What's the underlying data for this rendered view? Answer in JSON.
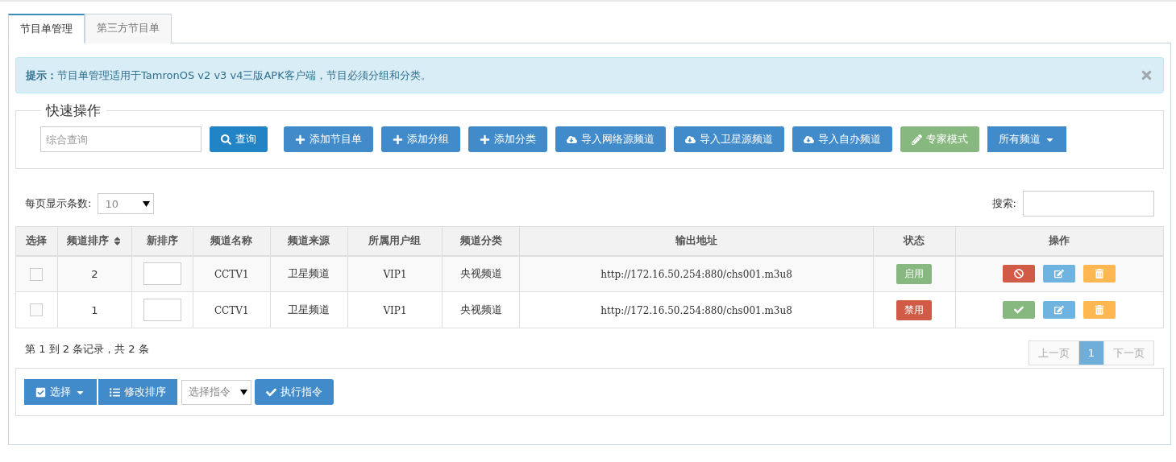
{
  "tabs": [
    {
      "label": "节目单管理",
      "selected": true
    },
    {
      "label": "第三方节目单",
      "selected": false
    }
  ],
  "alert": {
    "label": "提示：",
    "text": "节目单管理适用于TamronOS v2 v3 v4三版APK客户端，节目必须分组和分类。"
  },
  "quick_ops": {
    "legend": "快速操作",
    "search": {
      "placeholder": "综合查询"
    },
    "query_button": {
      "label": "查询"
    },
    "buttons": [
      {
        "label": "添加节目单",
        "kind": "add"
      },
      {
        "label": "添加分组",
        "kind": "add"
      },
      {
        "label": "添加分类",
        "kind": "add"
      },
      {
        "label": "导入网络源频道",
        "kind": "import"
      },
      {
        "label": "导入卫星源频道",
        "kind": "import"
      },
      {
        "label": "导入自办频道",
        "kind": "import"
      },
      {
        "label": "专家模式",
        "kind": "expert"
      },
      {
        "label": "所有频道",
        "kind": "dropdown"
      }
    ]
  },
  "page_size": {
    "label": "每页显示条数:",
    "value": "10"
  },
  "search": {
    "label": "搜索:"
  },
  "table": {
    "columns": [
      {
        "label": "选择",
        "sortable": false
      },
      {
        "label": "频道排序",
        "sortable": true
      },
      {
        "label": "新排序",
        "sortable": false
      },
      {
        "label": "频道名称",
        "sortable": false
      },
      {
        "label": "频道来源",
        "sortable": false
      },
      {
        "label": "所属用户组",
        "sortable": false
      },
      {
        "label": "频道分类",
        "sortable": false
      },
      {
        "label": "输出地址",
        "sortable": false
      },
      {
        "label": "状态",
        "sortable": false
      },
      {
        "label": "操作",
        "sortable": false
      }
    ],
    "rows": [
      {
        "checked": false,
        "order": "2",
        "name": "CCTV1",
        "source": "卫星频道",
        "group": "VIP1",
        "category": "央视频道",
        "url": "http://172.16.50.254:880/chs001.m3u8",
        "status": {
          "label": "启用",
          "enabled": true
        }
      },
      {
        "checked": false,
        "order": "1",
        "name": "CCTV1",
        "source": "卫星频道",
        "group": "VIP1",
        "category": "央视频道",
        "url": "http://172.16.50.254:880/chs001.m3u8",
        "status": {
          "label": "禁用",
          "enabled": false
        }
      }
    ]
  },
  "info": "第 1 到 2 条记录，共 2 条",
  "pagination": [
    {
      "label": "上一页",
      "selected": false,
      "disabled": true
    },
    {
      "label": "1",
      "selected": true,
      "disabled": false
    },
    {
      "label": "下一页",
      "selected": false,
      "disabled": true
    }
  ],
  "bottom": {
    "select_button": {
      "label": "选择"
    },
    "reorder_button": {
      "label": "修改排序"
    },
    "command": {
      "placeholder": "选择指令"
    },
    "execute_button": {
      "label": "执行指令"
    }
  }
}
